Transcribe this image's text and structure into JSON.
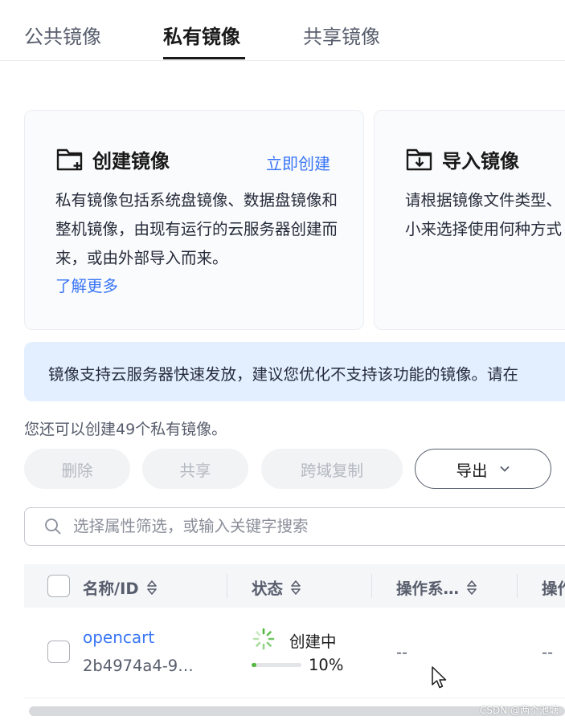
{
  "tabs": [
    {
      "label": "公共镜像",
      "active": false
    },
    {
      "label": "私有镜像",
      "active": true
    },
    {
      "label": "共享镜像",
      "active": false
    }
  ],
  "cards": {
    "create": {
      "title": "创建镜像",
      "action": "立即创建",
      "description": "私有镜像包括系统盘镜像、数据盘镜像和整机镜像，由现有运行的云服务器创建而来，或由外部导入而来。",
      "more": "了解更多",
      "icon": "folder-plus-icon"
    },
    "import": {
      "title": "导入镜像",
      "description_line1": "请根据镜像文件类型、",
      "description_line2": "小来选择使用何种方式",
      "icon": "folder-download-icon"
    }
  },
  "banner": {
    "text": "镜像支持云服务器快速发放，建议您优化不支持该功能的镜像。请在"
  },
  "quota": "您还可以创建49个私有镜像。",
  "toolbar": {
    "delete_label": "删除",
    "share_label": "共享",
    "cross_region_label": "跨域复制",
    "export_label": "导出"
  },
  "search": {
    "placeholder": "选择属性筛选，或输入关键字搜索"
  },
  "table": {
    "columns": [
      "名称/ID",
      "状态",
      "操作系…",
      "操作"
    ],
    "rows": [
      {
        "name": "opencart",
        "id": "2b4974a4-9…",
        "status": "创建中",
        "progress_percent": 10,
        "progress_label": "10%",
        "os": "--",
        "op": "--"
      }
    ]
  },
  "watermark": "CSDN @两个池塘",
  "colors": {
    "link": "#3a76f6",
    "banner_bg": "#e3efff",
    "progress": "#50b83c"
  }
}
